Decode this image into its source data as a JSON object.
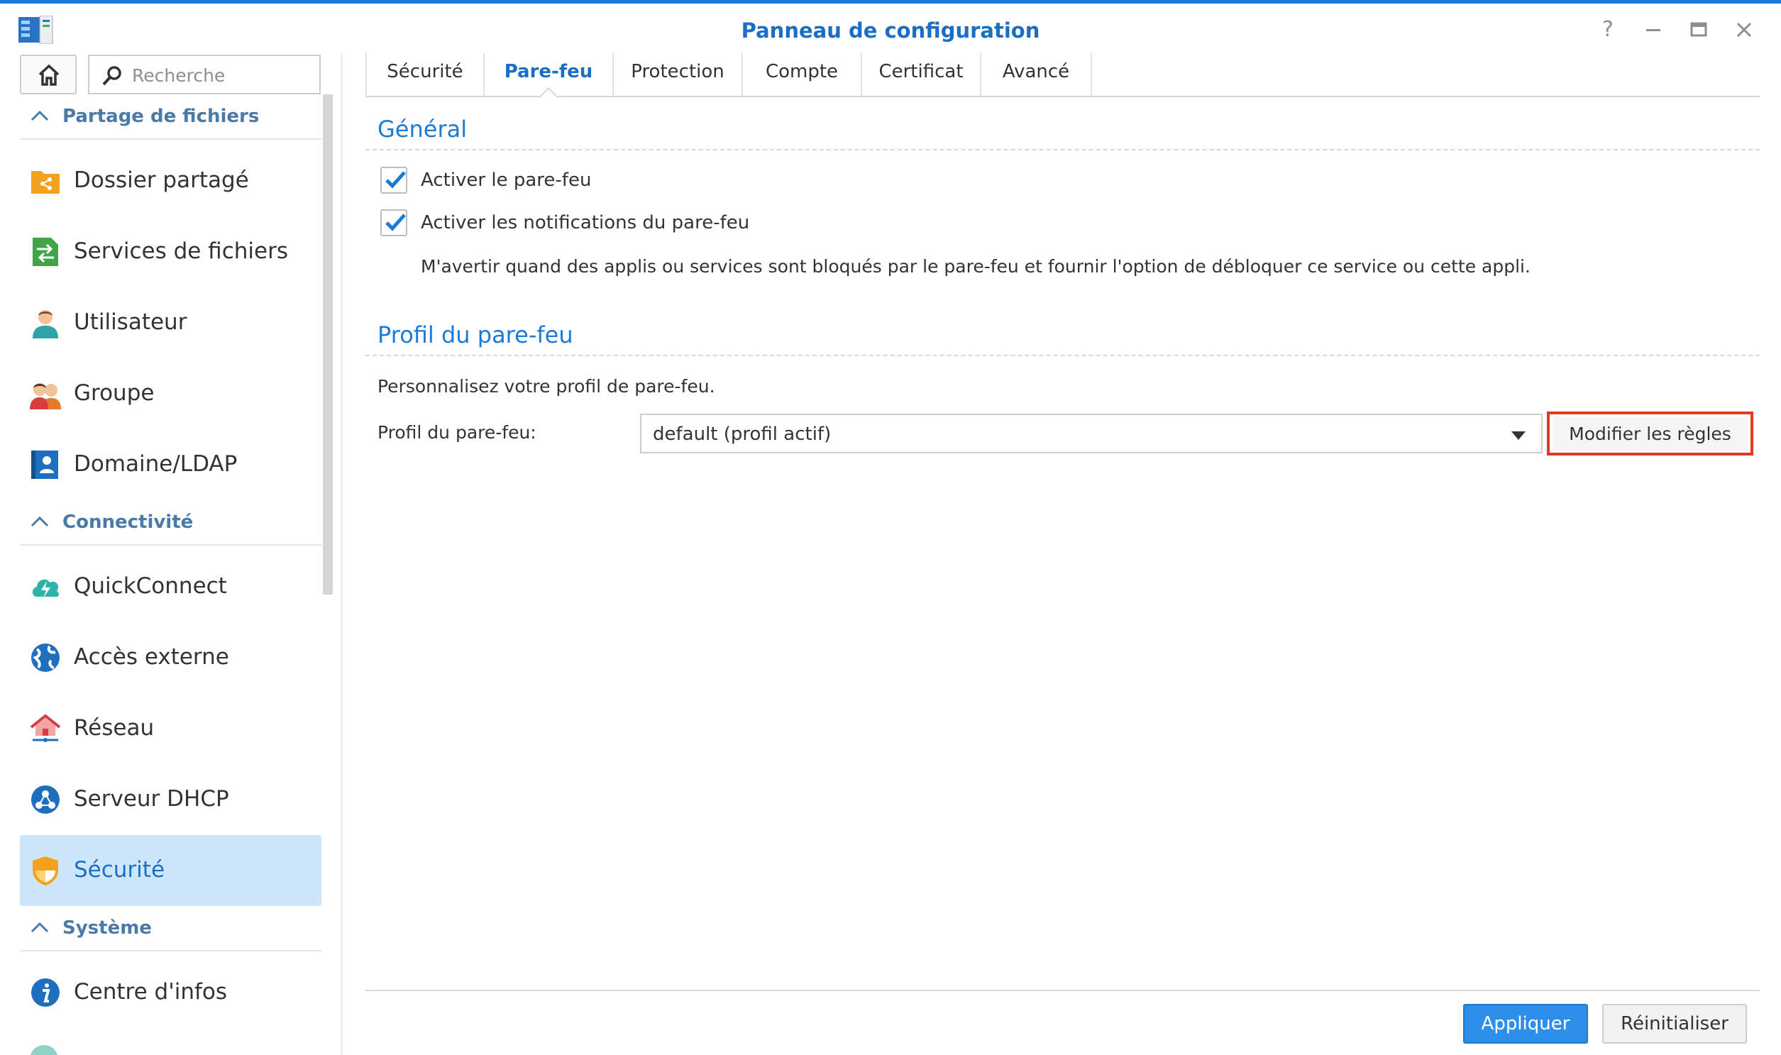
{
  "window": {
    "title": "Panneau de configuration"
  },
  "search": {
    "placeholder": "Recherche"
  },
  "sidebar": {
    "sections": [
      {
        "label": "Partage de fichiers"
      },
      {
        "label": "Connectivité"
      },
      {
        "label": "Système"
      }
    ],
    "items": [
      {
        "label": "Dossier partagé",
        "icon": "shared-folder-icon"
      },
      {
        "label": "Services de fichiers",
        "icon": "file-services-icon"
      },
      {
        "label": "Utilisateur",
        "icon": "user-icon"
      },
      {
        "label": "Groupe",
        "icon": "group-icon"
      },
      {
        "label": "Domaine/LDAP",
        "icon": "domain-ldap-icon"
      },
      {
        "label": "QuickConnect",
        "icon": "quickconnect-icon"
      },
      {
        "label": "Accès externe",
        "icon": "external-access-icon"
      },
      {
        "label": "Réseau",
        "icon": "network-icon"
      },
      {
        "label": "Serveur DHCP",
        "icon": "dhcp-server-icon"
      },
      {
        "label": "Sécurité",
        "icon": "security-icon",
        "active": true
      },
      {
        "label": "Centre d'infos",
        "icon": "info-center-icon"
      }
    ]
  },
  "tabs": [
    {
      "label": "Sécurité"
    },
    {
      "label": "Pare-feu",
      "active": true
    },
    {
      "label": "Protection"
    },
    {
      "label": "Compte"
    },
    {
      "label": "Certificat"
    },
    {
      "label": "Avancé"
    }
  ],
  "general": {
    "title": "Général",
    "enable_firewall": {
      "label": "Activer le pare-feu",
      "checked": true
    },
    "enable_notifications": {
      "label": "Activer les notifications du pare-feu",
      "checked": true
    },
    "notification_desc": "M'avertir quand des applis ou services sont bloqués par le pare-feu et fournir l'option de débloquer ce service ou cette appli."
  },
  "profile": {
    "title": "Profil du pare-feu",
    "intro": "Personnalisez votre profil de pare-feu.",
    "field_label": "Profil du pare-feu:",
    "selected": "default (profil actif)",
    "edit_button": "Modifier les règles"
  },
  "footer": {
    "apply": "Appliquer",
    "reset": "Réinitialiser"
  },
  "colors": {
    "accent": "#1a7ad8",
    "active_bg": "#cde6fb",
    "highlight": "#e03a21",
    "primary_button": "#2d8fea"
  }
}
